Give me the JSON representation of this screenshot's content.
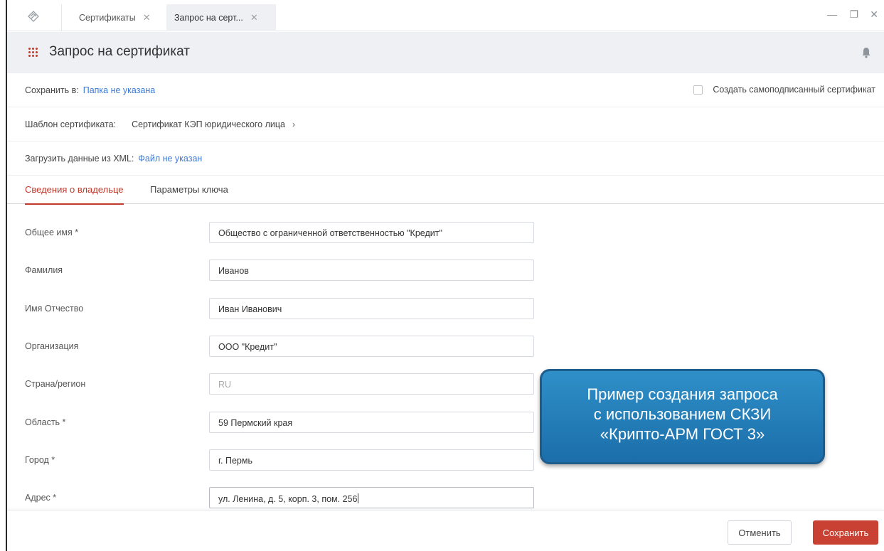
{
  "tabs": [
    {
      "label": "Сертификаты"
    },
    {
      "label": "Запрос на серт..."
    }
  ],
  "header": {
    "title": "Запрос на сертификат"
  },
  "save_to": {
    "label": "Сохранить в:",
    "value": "Папка не указана"
  },
  "self_signed": {
    "label": "Создать самоподписанный сертификат",
    "checked": false
  },
  "template": {
    "label": "Шаблон сертификата:",
    "value": "Сертификат КЭП юридического лица"
  },
  "xml": {
    "label": "Загрузить данные из XML:",
    "value": "Файл не указан"
  },
  "subtabs": {
    "active": "Сведения о владельце",
    "inactive": "Параметры ключа"
  },
  "fields": [
    {
      "label": "Общее имя *",
      "value": "Общество с ограниченной ответственностью \"Кредит\""
    },
    {
      "label": "Фамилия",
      "value": "Иванов"
    },
    {
      "label": "Имя Отчество",
      "value": "Иван Иванович"
    },
    {
      "label": "Организация",
      "value": "ООО \"Кредит\""
    },
    {
      "label": "Страна/регион",
      "value": "RU"
    },
    {
      "label": "Область *",
      "value": "59 Пермский края"
    },
    {
      "label": "Город *",
      "value": "г. Пермь"
    },
    {
      "label": "Адрес *",
      "value": "ул. Ленина, д. 5, корп. 3, пом. 256"
    }
  ],
  "callout": {
    "line1": "Пример создания запроса",
    "line2": "с использованием СКЗИ",
    "line3": "«Крипто-АРМ ГОСТ 3»"
  },
  "footer": {
    "cancel": "Отменить",
    "save": "Сохранить"
  },
  "colors": {
    "accent": "#c0392b",
    "link": "#3e7ad6",
    "callout": "#1f7bb8"
  }
}
